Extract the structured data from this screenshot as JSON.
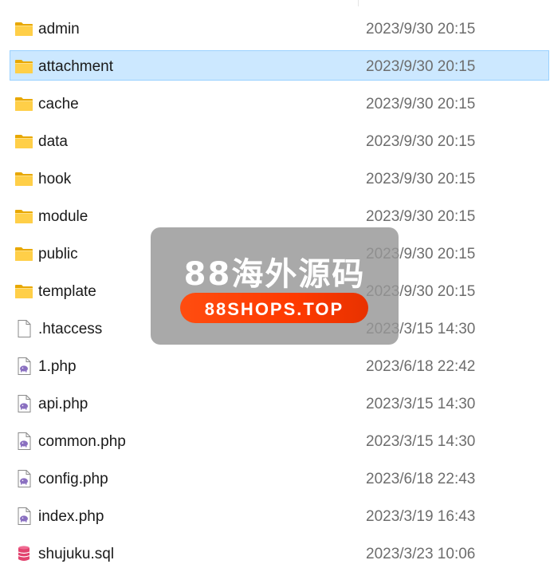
{
  "files": [
    {
      "name": "admin",
      "date": "2023/9/30 20:15",
      "type": "folder",
      "icon": "folder-icon"
    },
    {
      "name": "attachment",
      "date": "2023/9/30 20:15",
      "type": "folder",
      "icon": "folder-icon",
      "selected": true
    },
    {
      "name": "cache",
      "date": "2023/9/30 20:15",
      "type": "folder",
      "icon": "folder-icon"
    },
    {
      "name": "data",
      "date": "2023/9/30 20:15",
      "type": "folder",
      "icon": "folder-icon"
    },
    {
      "name": "hook",
      "date": "2023/9/30 20:15",
      "type": "folder",
      "icon": "folder-icon"
    },
    {
      "name": "module",
      "date": "2023/9/30 20:15",
      "type": "folder",
      "icon": "folder-icon"
    },
    {
      "name": "public",
      "date": "2023/9/30 20:15",
      "type": "folder",
      "icon": "folder-icon"
    },
    {
      "name": "template",
      "date": "2023/9/30 20:15",
      "type": "folder",
      "icon": "folder-icon"
    },
    {
      "name": ".htaccess",
      "date": "2023/3/15 14:30",
      "type": "file",
      "icon": "blank-file-icon"
    },
    {
      "name": "1.php",
      "date": "2023/6/18 22:42",
      "type": "php",
      "icon": "php-file-icon"
    },
    {
      "name": "api.php",
      "date": "2023/3/15 14:30",
      "type": "php",
      "icon": "php-file-icon"
    },
    {
      "name": "common.php",
      "date": "2023/3/15 14:30",
      "type": "php",
      "icon": "php-file-icon"
    },
    {
      "name": "config.php",
      "date": "2023/6/18 22:43",
      "type": "php",
      "icon": "php-file-icon"
    },
    {
      "name": "index.php",
      "date": "2023/3/19 16:43",
      "type": "php",
      "icon": "php-file-icon"
    },
    {
      "name": "shujuku.sql",
      "date": "2023/3/23 10:06",
      "type": "sql",
      "icon": "sql-file-icon"
    }
  ],
  "watermark": {
    "title": "88海外源码",
    "url": "88SHOPS.TOP"
  },
  "colors": {
    "selection_bg": "#cce8ff",
    "selection_border": "#99d1ff",
    "folder_yellow": "#ffca28",
    "php_purple": "#8a6fc0",
    "sql_red": "#e8507a",
    "watermark_orange": "#ff4010"
  }
}
